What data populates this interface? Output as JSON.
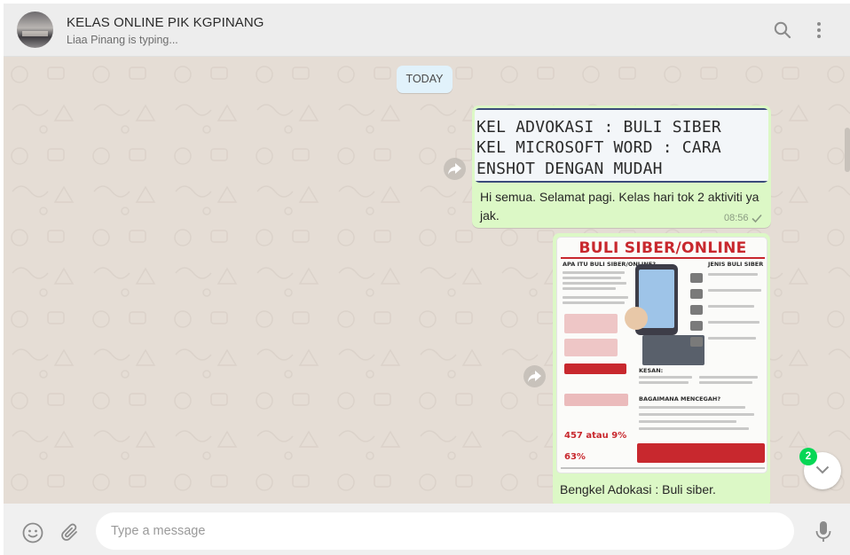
{
  "header": {
    "title": "KELAS ONLINE PIK KGPINANG",
    "status": "Liaa Pinang is typing...",
    "icons": [
      "search-icon",
      "menu-icon"
    ]
  },
  "chat": {
    "day_label": "TODAY",
    "messages": [
      {
        "type": "text-with-quote",
        "quoted_lines": [
          "KEL ADVOKASI : BULI SIBER",
          "KEL MICROSOFT WORD : CARA",
          "ENSHOT DENGAN MUDAH"
        ],
        "text": "Hi semua. Selamat pagi. Kelas hari tok 2 aktiviti ya jak.",
        "time": "08:56",
        "status_icon": "single-tick-icon"
      },
      {
        "type": "image",
        "image_title": "BULI SIBER/ONLINE",
        "image_sections": [
          "APA ITU BULI SIBER/ONLINE?",
          "JENIS BULI SIBER",
          "KESAN:",
          "BAGAIMANA MENCEGAH?"
        ],
        "image_stats": [
          "457 atau 9%",
          "63%"
        ],
        "caption": "Bengkel Adokasi : Buli siber."
      }
    ],
    "unread_count": "2"
  },
  "footer": {
    "placeholder": "Type a message",
    "icons": [
      "emoji-icon",
      "attach-icon",
      "mic-icon"
    ]
  },
  "colors": {
    "outgoing_bubble": "#dcf8c6",
    "chat_background": "#e5ddd5",
    "badge": "#06d755",
    "header": "#ededed"
  }
}
